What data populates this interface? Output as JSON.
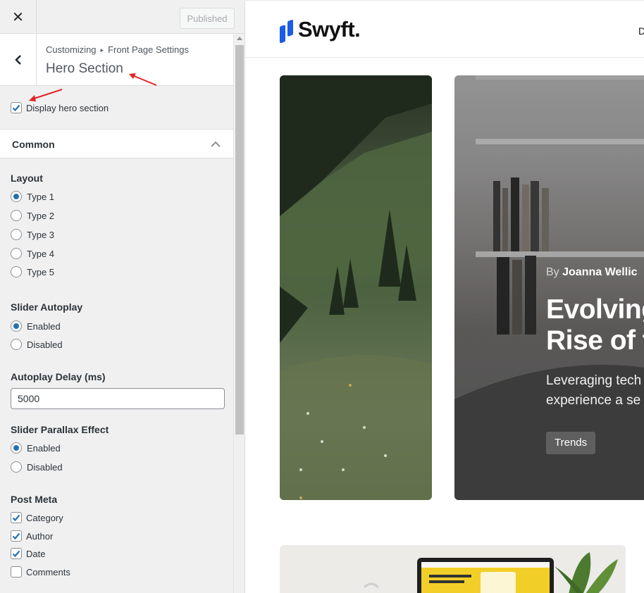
{
  "topbar": {
    "close_label": "✕",
    "publish_label": "Published"
  },
  "section": {
    "breadcrumb_root": "Customizing",
    "breadcrumb_sep": "▸",
    "breadcrumb_parent": "Front Page Settings",
    "title": "Hero Section"
  },
  "display_hero": {
    "label": "Display hero section",
    "checked": true
  },
  "common_panel": {
    "label": "Common",
    "expanded": true
  },
  "layout": {
    "label": "Layout",
    "options": [
      "Type 1",
      "Type 2",
      "Type 3",
      "Type 4",
      "Type 5"
    ],
    "selected": "Type 1"
  },
  "slider_autoplay": {
    "label": "Slider Autoplay",
    "options": [
      "Enabled",
      "Disabled"
    ],
    "selected": "Enabled"
  },
  "autoplay_delay": {
    "label": "Autoplay Delay (ms)",
    "value": "5000"
  },
  "slider_parallax": {
    "label": "Slider Parallax Effect",
    "options": [
      "Enabled",
      "Disabled"
    ],
    "selected": "Enabled"
  },
  "post_meta": {
    "label": "Post Meta",
    "items": [
      {
        "label": "Category",
        "checked": true
      },
      {
        "label": "Author",
        "checked": true
      },
      {
        "label": "Date",
        "checked": true
      },
      {
        "label": "Comments",
        "checked": false
      }
    ]
  },
  "preview": {
    "logo_text": "Swyft.",
    "nav_stub": "D",
    "hero": {
      "byline_prefix": "By",
      "byline_author": "Joanna Wellic",
      "title_line1": "Evolving",
      "title_line2": "Rise of t",
      "excerpt_line1": "Leveraging tech",
      "excerpt_line2": "experience a se",
      "tag": "Trends"
    }
  },
  "colors": {
    "accent": "#2271b1",
    "brand": "#1a5ce5",
    "annotation": "#e32222"
  }
}
